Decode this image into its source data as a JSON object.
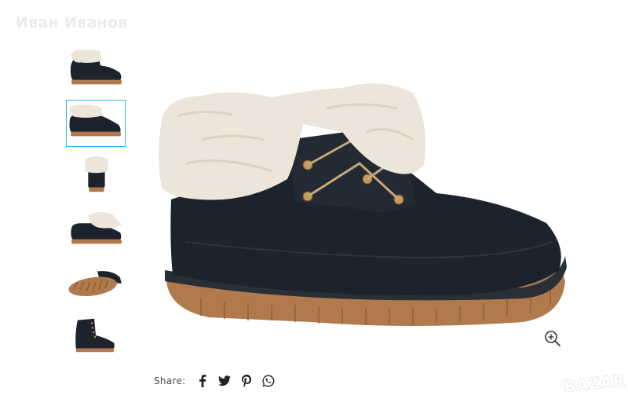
{
  "seller": {
    "name": "Иван Иванов"
  },
  "gallery": {
    "thumbnails": [
      {
        "view": "side-fur"
      },
      {
        "view": "side-fur-profile",
        "active": true
      },
      {
        "view": "back"
      },
      {
        "view": "side-fur-small"
      },
      {
        "view": "sole"
      },
      {
        "view": "laced-up"
      }
    ],
    "zoom": {
      "icon": "zoom-in-icon"
    }
  },
  "share": {
    "label": "Share:",
    "icons": [
      "facebook-icon",
      "twitter-icon",
      "pinterest-icon",
      "whatsapp-icon"
    ]
  },
  "watermark": {
    "text": "BAZAR"
  },
  "colors": {
    "accent": "#32b5e6",
    "boot": "#1d232c",
    "fur": "#ece6da",
    "sole": "#b07a4c"
  }
}
